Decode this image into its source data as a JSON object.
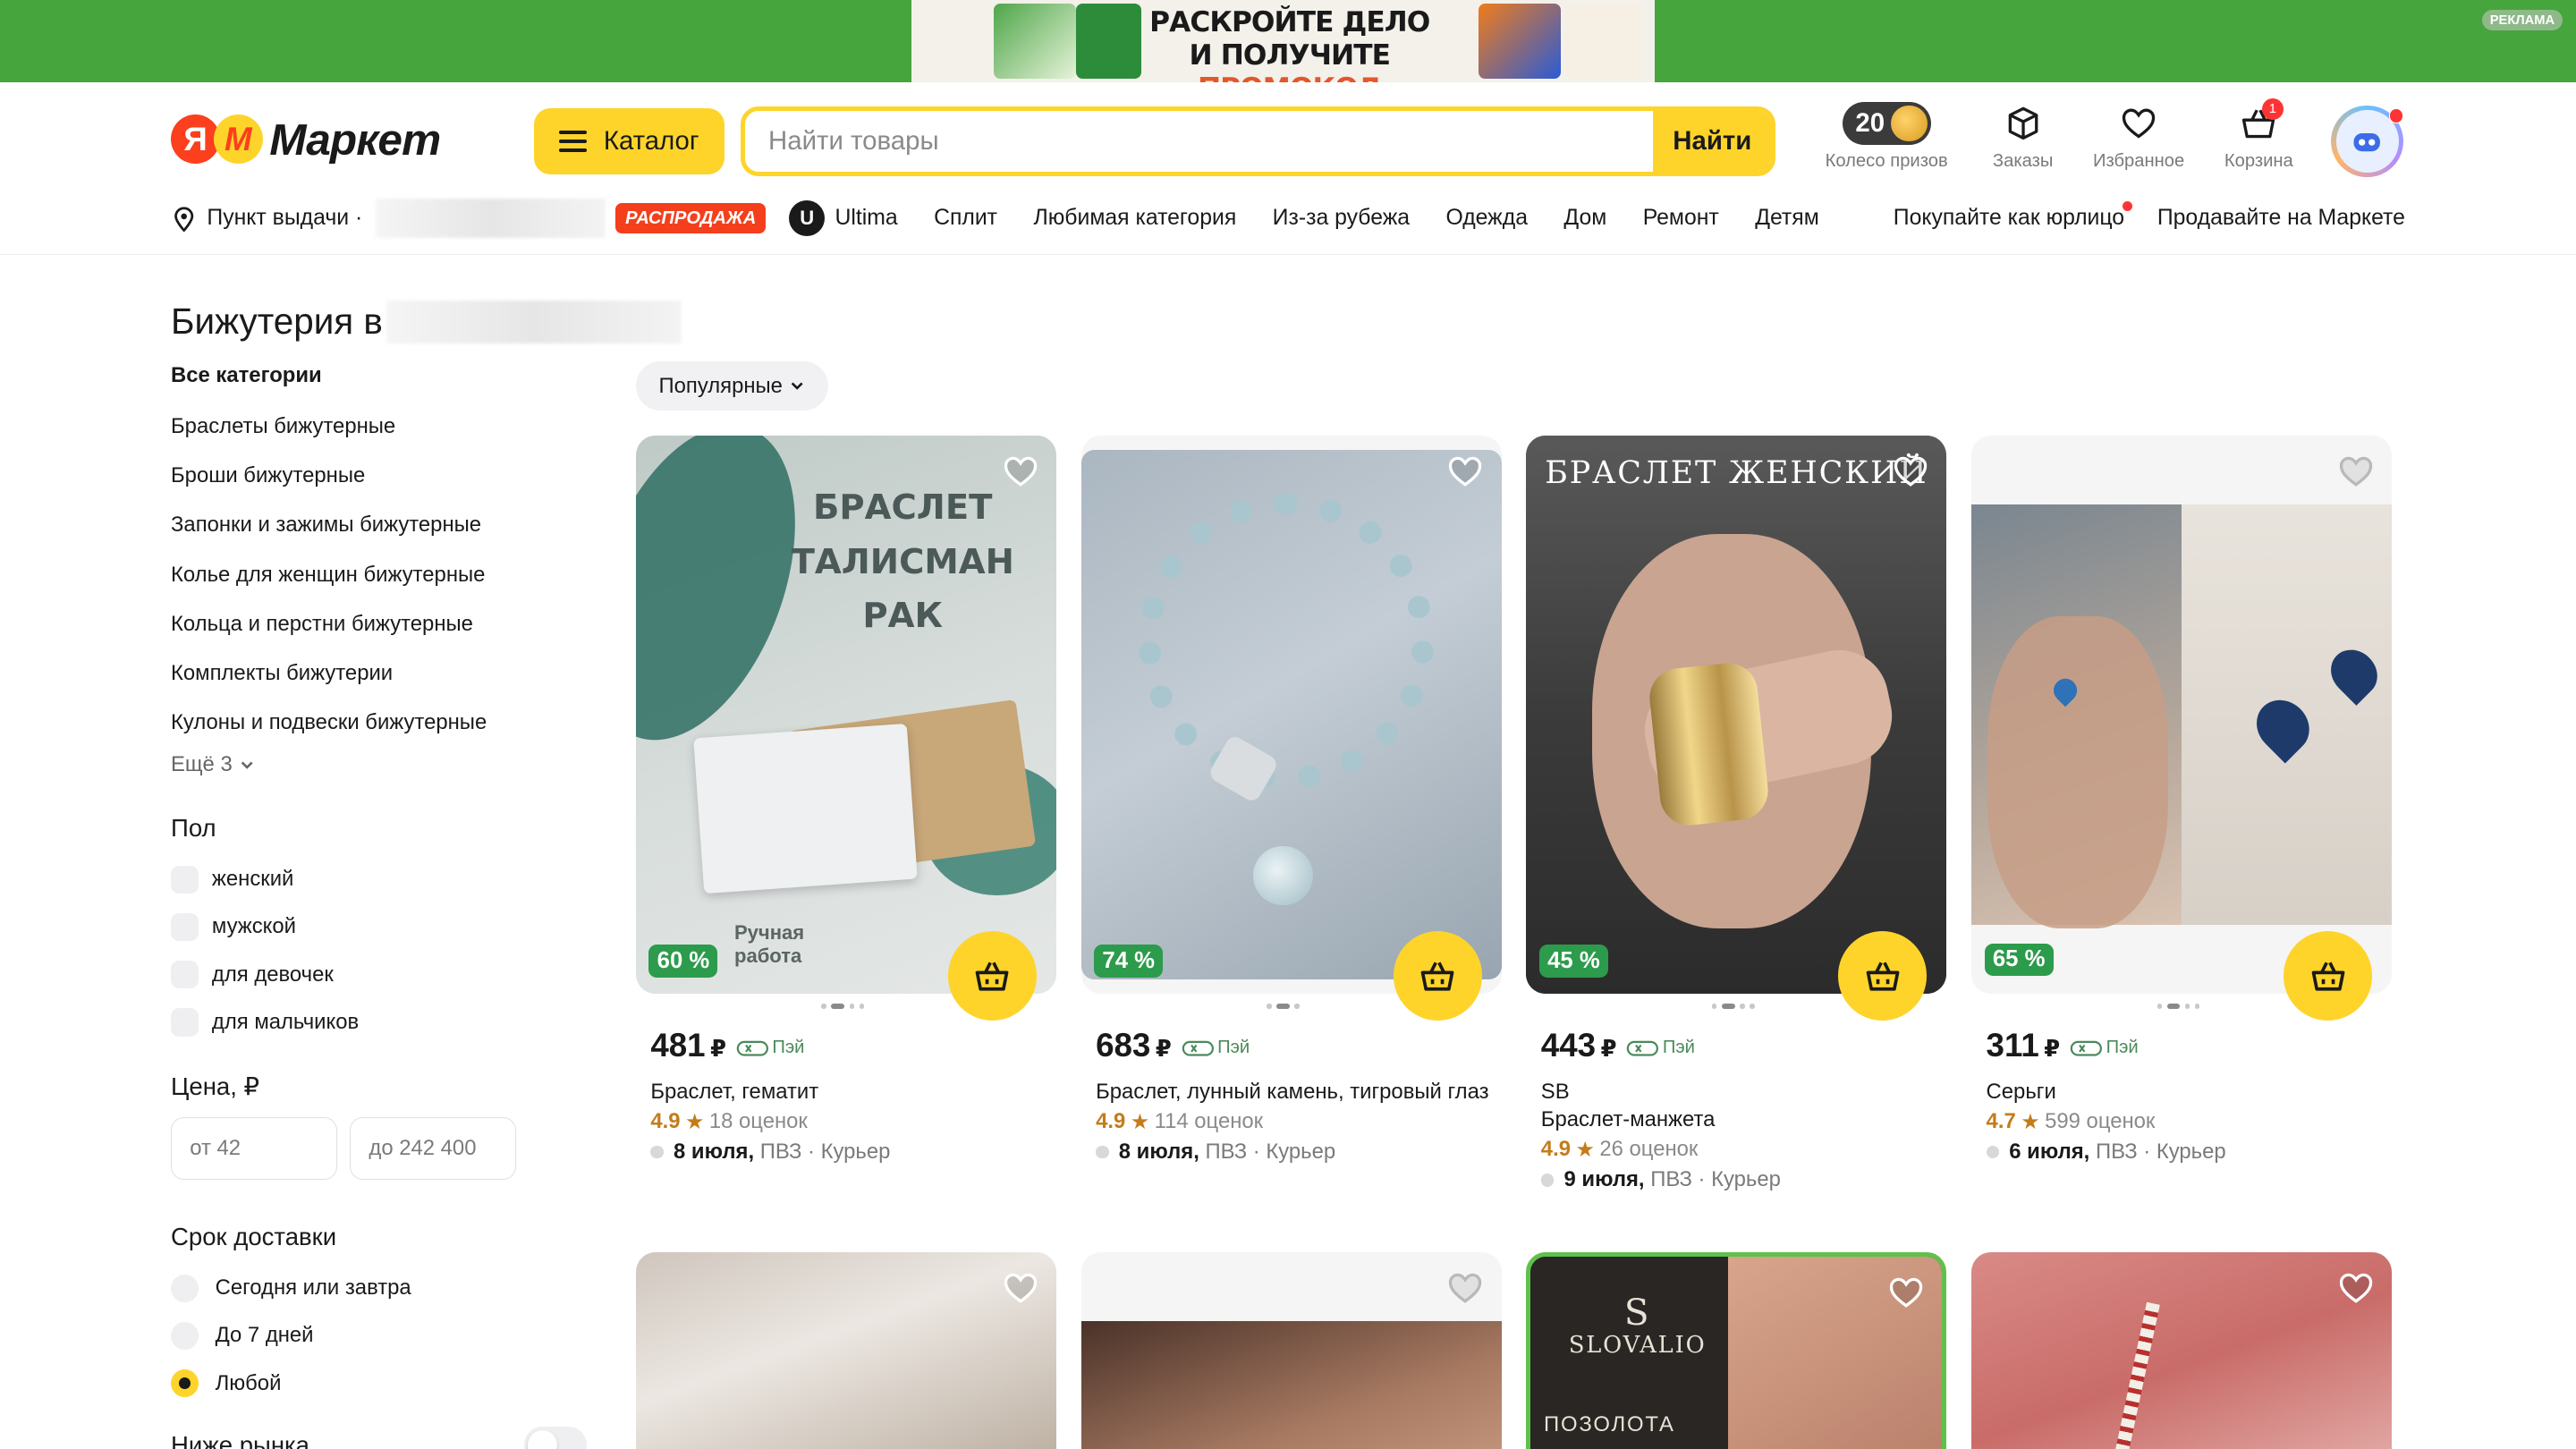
{
  "ad": {
    "line1": "РАСКРОЙТЕ ДЕЛО",
    "line2_a": "И ПОЛУЧИТЕ ",
    "line2_b": "ПРОМОКОД",
    "badge": "РЕКЛАМА"
  },
  "header": {
    "logo_letter": "Я",
    "logo_text": "Маркет",
    "catalog_label": "Каталог",
    "search_placeholder": "Найти товары",
    "search_button": "Найти",
    "prize_count": "20",
    "prize_label": "Колесо призов",
    "orders_label": "Заказы",
    "favorites_label": "Избранное",
    "cart_label": "Корзина",
    "cart_count": "1"
  },
  "nav": {
    "pickup": "Пункт выдачи ·",
    "sale_badge": "РАСПРОДАЖА",
    "ultima_logo": "U",
    "items": [
      "Ultima",
      "Сплит",
      "Любимая категория",
      "Из-за рубежа",
      "Одежда",
      "Дом",
      "Ремонт",
      "Детям"
    ],
    "right": [
      "Покупайте как юрлицо",
      "Продавайте на Маркете"
    ]
  },
  "sidebar": {
    "title": "Бижутерия в",
    "categories_head": "Все категории",
    "categories": [
      "Браслеты бижутерные",
      "Броши бижутерные",
      "Запонки и зажимы бижутерные",
      "Колье для женщин бижутерные",
      "Кольца и перстни бижутерные",
      "Комплекты бижутерии",
      "Кулоны и подвески бижутерные"
    ],
    "more": "Ещё 3",
    "gender_title": "Пол",
    "genders": [
      "женский",
      "мужской",
      "для девочек",
      "для мальчиков"
    ],
    "price_title": "Цена, ₽",
    "price_from": "от 42",
    "price_to": "до 242 400",
    "delivery_title": "Срок доставки",
    "delivery_options": [
      "Сегодня или завтра",
      "До 7 дней",
      "Любой"
    ],
    "delivery_selected": "Любой",
    "below_market": "Ниже рынка"
  },
  "sort": {
    "label": "Популярные"
  },
  "products": [
    {
      "price": "481",
      "currency": "₽",
      "pay": "Пэй",
      "name": "Браслет, гематит",
      "rating": "4.9",
      "reviews": "18 оценок",
      "date": "8 июля,",
      "delivery": "ПВЗ · Курьер",
      "discount": "60 %",
      "img_text_1": "БРАСЛЕТ",
      "img_text_2": "ТАЛИСМАН",
      "img_text_3": "РАК",
      "img_caption": "Ручная работа"
    },
    {
      "price": "683",
      "currency": "₽",
      "pay": "Пэй",
      "name": "Браслет, лунный камень, тигровый глаз",
      "rating": "4.9",
      "reviews": "114 оценок",
      "date": "8 июля,",
      "delivery": "ПВЗ · Курьер",
      "discount": "74 %"
    },
    {
      "price": "443",
      "currency": "₽",
      "pay": "Пэй",
      "brand": "SB",
      "name": "Браслет-манжета",
      "rating": "4.9",
      "reviews": "26 оценок",
      "date": "9 июля,",
      "delivery": "ПВЗ · Курьер",
      "discount": "45 %",
      "img_text_1": "БРАСЛЕТ ЖЕНСКИЙ"
    },
    {
      "price": "311",
      "currency": "₽",
      "pay": "Пэй",
      "name": "Серьги",
      "rating": "4.7",
      "reviews": "599 оценок",
      "date": "6 июля,",
      "delivery": "ПВЗ · Курьер",
      "discount": "65 %"
    }
  ],
  "products_row2": [
    {
      "img_text_1": ""
    },
    {
      "img_text_1": ""
    },
    {
      "img_text_1": "SLOVALIO",
      "img_text_2": "ПОЗОЛОТА"
    },
    {
      "img_text_1": ""
    }
  ],
  "colors": {
    "accent": "#fed42b",
    "ad_green": "#46a53c",
    "discount_green": "#2c9b4b",
    "sale_red": "#f43f1c",
    "rating": "#c47c1a"
  }
}
